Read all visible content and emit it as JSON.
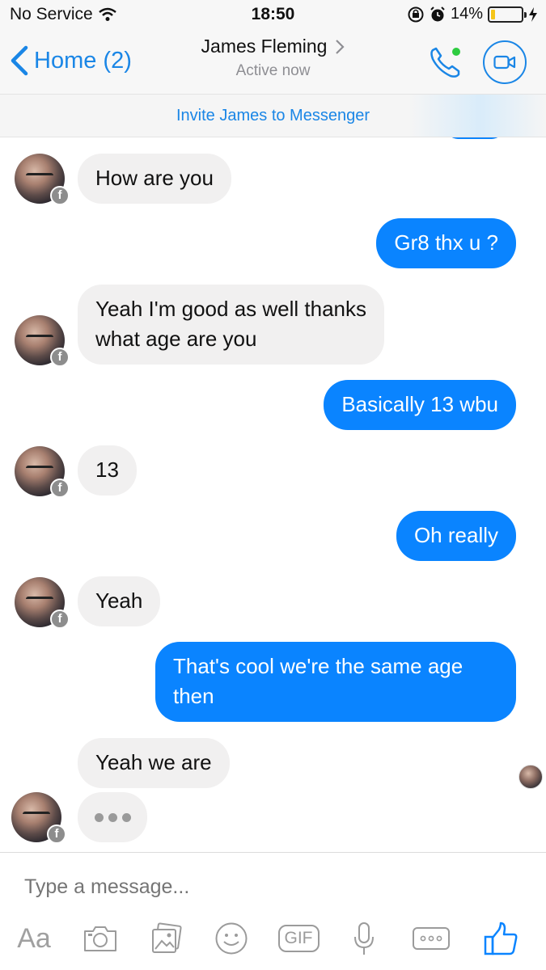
{
  "status_bar": {
    "carrier": "No Service",
    "time": "18:50",
    "battery_percent": "14%",
    "battery_level": 0.14,
    "icons": [
      "wifi-icon",
      "rotation-lock-icon",
      "alarm-icon",
      "battery-icon",
      "charging-bolt-icon"
    ]
  },
  "nav": {
    "back_label": "Home (2)",
    "contact_name": "James Fleming",
    "presence": "Active now",
    "icons": [
      "chevron-left-icon",
      "chevron-right-icon",
      "phone-icon",
      "video-icon"
    ],
    "active_dot_color": "#2ecc40"
  },
  "invite": {
    "label": "Invite James to Messenger"
  },
  "messages": [
    {
      "from": "them",
      "lines": [
        "How are you"
      ]
    },
    {
      "from": "me",
      "lines": [
        "Gr8 thx u ?"
      ]
    },
    {
      "from": "them",
      "lines": [
        "Yeah I'm good as well thanks",
        "what age are you"
      ]
    },
    {
      "from": "me",
      "lines": [
        "Basically 13 wbu"
      ]
    },
    {
      "from": "them",
      "lines": [
        "13"
      ]
    },
    {
      "from": "me",
      "lines": [
        "Oh really"
      ]
    },
    {
      "from": "them",
      "lines": [
        "Yeah"
      ]
    },
    {
      "from": "me",
      "lines": [
        "That's cool we're the same age",
        "then"
      ]
    },
    {
      "from": "them",
      "lines": [
        "Yeah we are"
      ]
    }
  ],
  "composer": {
    "placeholder": "Type a message...",
    "text_tool_label": "Aa",
    "gif_label": "GIF",
    "tools": [
      "text-format",
      "camera-icon",
      "gallery-icon",
      "emoji-icon",
      "gif-button",
      "microphone-icon",
      "more-icon",
      "thumbs-up-icon"
    ]
  },
  "colors": {
    "accent": "#0a84ff",
    "link": "#1a86e6",
    "incoming_bubble": "#f1f0f0",
    "battery_fill": "#f5c518"
  }
}
